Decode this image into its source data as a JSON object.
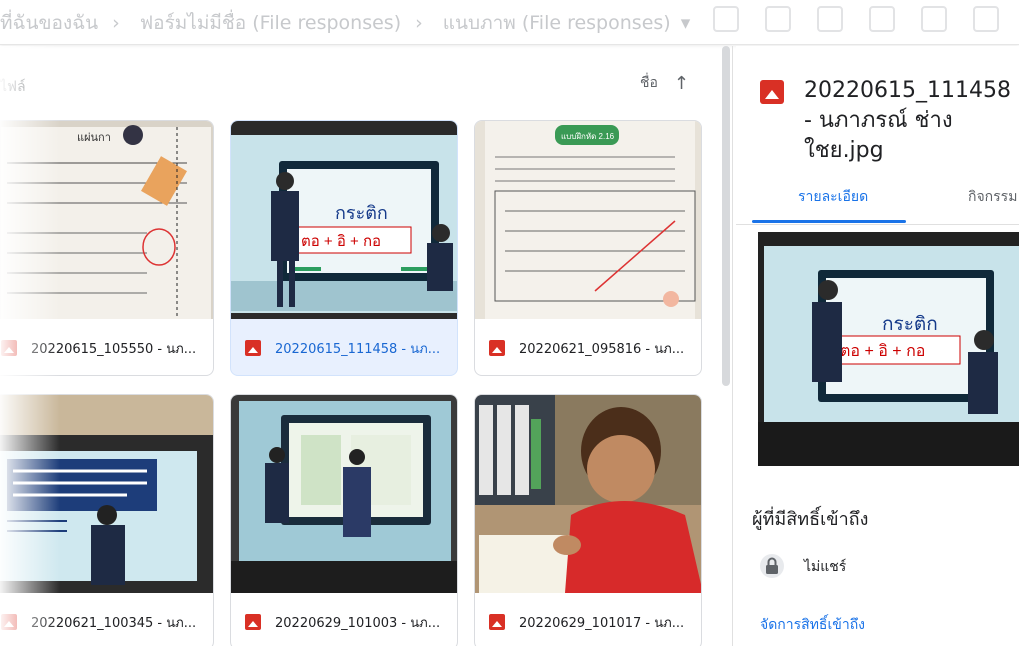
{
  "breadcrumbs": [
    "ที่ฉันของฉัน",
    "ฟอร์มไม่มีชื่อ (File responses)",
    "แนบภาพ (File responses)"
  ],
  "main": {
    "label": "ไฟล์",
    "sort_label": "ชื่อ",
    "sort_icon": "arrow-up-icon",
    "files": [
      {
        "name": "20220615_105550 - นภ..."
      },
      {
        "name": "20220615_111458 - นภ..."
      },
      {
        "name": "20220621_095816 - นภ..."
      },
      {
        "name": "20220621_100345 - นภ..."
      },
      {
        "name": "20220629_101003 - นภ..."
      },
      {
        "name": "20220629_101017 - นภ..."
      }
    ]
  },
  "thumbs": {
    "board_word": "กระติก",
    "board_formula": "ตอ + อิ + กอ",
    "worksheet_badge": "แบบฝึกหัด 2.16",
    "worksheet_title": "แผ่นกา"
  },
  "details": {
    "title": "20220615_111458 - นภาภรณ์ ช่างใชย.jpg",
    "tabs": [
      "รายละเอียด",
      "กิจกรรม"
    ],
    "access_title": "ผู้ที่มีสิทธิ์เข้าถึง",
    "not_shared": "ไม่แชร์",
    "manage_link": "จัดการสิทธิ์เข้าถึง"
  },
  "colors": {
    "accent": "#1a73e8",
    "image_icon": "#d93025",
    "selected_bg": "#e8f0fe"
  }
}
